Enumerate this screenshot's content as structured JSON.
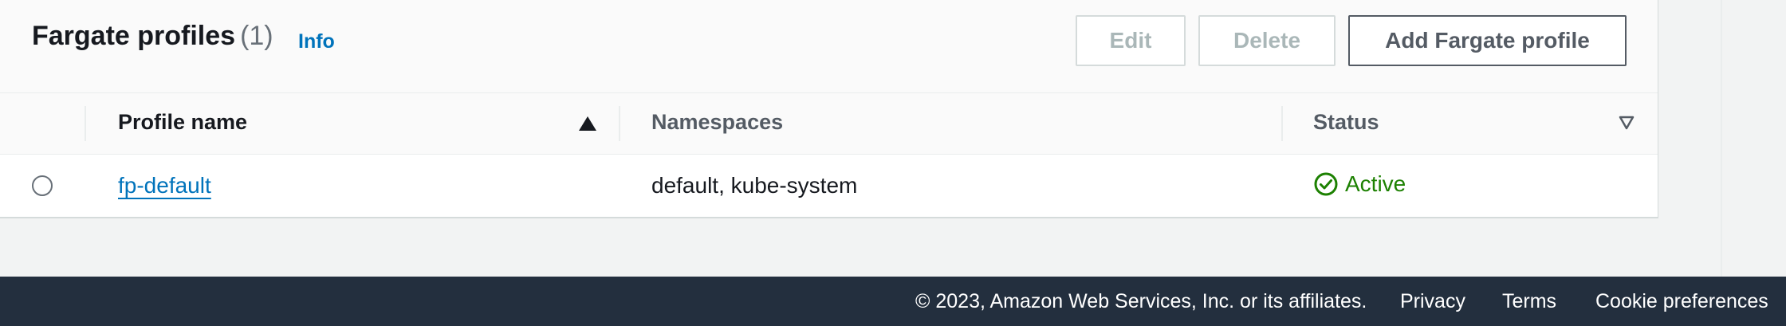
{
  "section": {
    "title": "Fargate profiles",
    "count": "(1)",
    "info_label": "Info"
  },
  "actions": {
    "edit_label": "Edit",
    "delete_label": "Delete",
    "add_label": "Add Fargate profile"
  },
  "table": {
    "columns": [
      "Profile name",
      "Namespaces",
      "Status"
    ],
    "sort": {
      "column": "Profile name",
      "direction": "ascending"
    },
    "rows": [
      {
        "selected": false,
        "profile_name": "fp-default",
        "namespaces": "default, kube-system",
        "status": "Active"
      }
    ]
  },
  "footer": {
    "copyright": "© 2023, Amazon Web Services, Inc. or its affiliates.",
    "links": [
      "Privacy",
      "Terms",
      "Cookie preferences"
    ]
  },
  "colors": {
    "link": "#0073bb",
    "status_active": "#1d8102",
    "footer_bg": "#232f3e",
    "disabled_text": "#aab7b8"
  },
  "icons": {
    "sort_ascending": "caret-up-icon",
    "sort_descending": "caret-down-outline-icon",
    "status_active": "check-circle-icon",
    "row_select": "radio-icon"
  }
}
